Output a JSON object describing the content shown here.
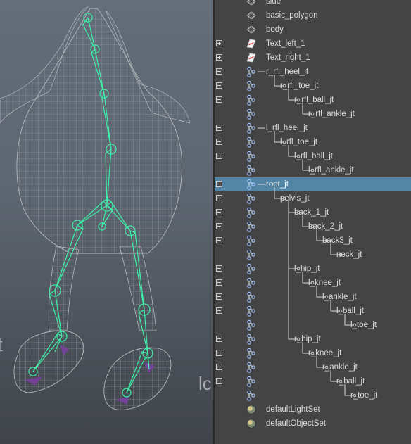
{
  "outliner": {
    "items": [
      {
        "label": "side",
        "icon": "mesh-icon",
        "expander": "",
        "indent": 0
      },
      {
        "label": "basic_polygon",
        "icon": "mesh-icon",
        "expander": "",
        "indent": 0
      },
      {
        "label": "body",
        "icon": "mesh-icon",
        "expander": "",
        "indent": 0
      },
      {
        "label": "Text_left_1",
        "icon": "curve-text-icon",
        "expander": "plus",
        "indent": 0
      },
      {
        "label": "Text_right_1",
        "icon": "curve-text-icon",
        "expander": "plus",
        "indent": 0
      },
      {
        "label": "r_rfl_heel_jt",
        "icon": "joint-icon",
        "expander": "minus",
        "indent": 0
      },
      {
        "label": "r_rfl_toe_jt",
        "icon": "joint-icon",
        "expander": "minus",
        "indent": 1
      },
      {
        "label": "r_rfl_ball_jt",
        "icon": "joint-icon",
        "expander": "minus",
        "indent": 2
      },
      {
        "label": "r_rfl_ankle_jt",
        "icon": "joint-icon",
        "expander": "",
        "indent": 3
      },
      {
        "label": "l_rfl_heel_jt",
        "icon": "joint-icon",
        "expander": "minus",
        "indent": 0
      },
      {
        "label": "l_rfl_toe_jt",
        "icon": "joint-icon",
        "expander": "minus",
        "indent": 1
      },
      {
        "label": "l_rfl_ball_jt",
        "icon": "joint-icon",
        "expander": "minus",
        "indent": 2
      },
      {
        "label": "l_rfl_ankle_jt",
        "icon": "joint-icon",
        "expander": "",
        "indent": 3
      },
      {
        "label": "root_jt",
        "icon": "joint-icon",
        "expander": "minus",
        "indent": 0,
        "selected": true
      },
      {
        "label": "pelvis_jt",
        "icon": "joint-icon",
        "expander": "minus",
        "indent": 1
      },
      {
        "label": "back_1_jt",
        "icon": "joint-icon",
        "expander": "minus",
        "indent": 2
      },
      {
        "label": "back_2_jt",
        "icon": "joint-icon",
        "expander": "minus",
        "indent": 3
      },
      {
        "label": "back3_jt",
        "icon": "joint-icon",
        "expander": "minus",
        "indent": 4
      },
      {
        "label": "neck_jt",
        "icon": "joint-icon",
        "expander": "",
        "indent": 5
      },
      {
        "label": "l_hip_jt",
        "icon": "joint-icon",
        "expander": "minus",
        "indent": 2
      },
      {
        "label": "l_knee_jt",
        "icon": "joint-icon",
        "expander": "minus",
        "indent": 3
      },
      {
        "label": "l_ankle_jt",
        "icon": "joint-icon",
        "expander": "minus",
        "indent": 4
      },
      {
        "label": "l_ball_jt",
        "icon": "joint-icon",
        "expander": "minus",
        "indent": 5
      },
      {
        "label": "l_toe_jt",
        "icon": "joint-icon",
        "expander": "",
        "indent": 6
      },
      {
        "label": "r_hip_jt",
        "icon": "joint-icon",
        "expander": "minus",
        "indent": 2
      },
      {
        "label": "r_knee_jt",
        "icon": "joint-icon",
        "expander": "minus",
        "indent": 3
      },
      {
        "label": "r_ankle_jt",
        "icon": "joint-icon",
        "expander": "minus",
        "indent": 4
      },
      {
        "label": "r_ball_jt",
        "icon": "joint-icon",
        "expander": "minus",
        "indent": 5
      },
      {
        "label": "r_toe_jt",
        "icon": "joint-icon",
        "expander": "",
        "indent": 6
      },
      {
        "label": "defaultLightSet",
        "icon": "set-icon",
        "expander": "",
        "indent": 0
      },
      {
        "label": "defaultObjectSet",
        "icon": "set-icon",
        "expander": "",
        "indent": 0
      }
    ]
  },
  "viewport": {
    "overlay_text": [
      "t",
      "lc"
    ],
    "colors": {
      "wireframe": "#b4b8bc",
      "skeleton": "#3ef0a8",
      "foot_accent": "#7a3ea0"
    }
  },
  "colors": {
    "selection": "#5285a6",
    "panel_bg": "#444444",
    "text": "#dcdcdc"
  }
}
